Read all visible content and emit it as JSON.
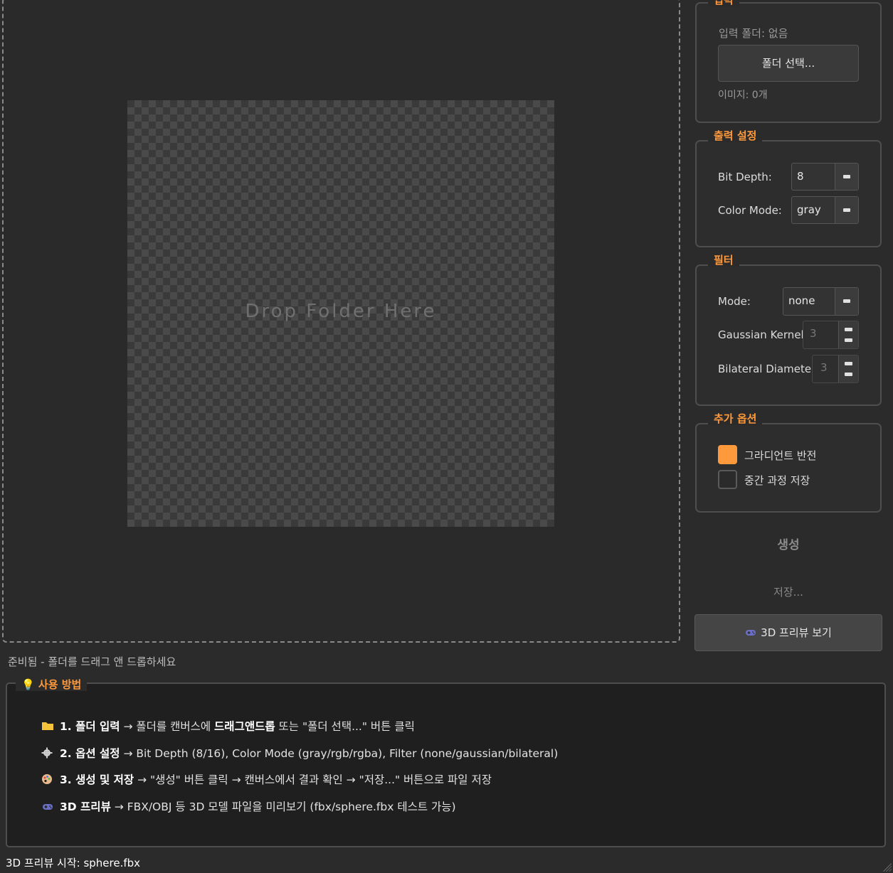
{
  "canvas": {
    "drop_text": "Drop Folder Here"
  },
  "status_message": "준비됨 - 폴더를 드래그 앤 드롭하세요",
  "input_group": {
    "title": "입력",
    "folder_label": "입력 폴더: 없음",
    "select_button": "폴더 선택...",
    "image_count": "이미지: 0개"
  },
  "output_group": {
    "title": "출력 설정",
    "bit_depth_label": "Bit Depth:",
    "bit_depth_value": "8",
    "color_mode_label": "Color Mode:",
    "color_mode_value": "gray"
  },
  "filter_group": {
    "title": "필터",
    "mode_label": "Mode:",
    "mode_value": "none",
    "gaussian_label": "Gaussian Kernel:",
    "gaussian_value": "3",
    "bilateral_label": "Bilateral Diameter:",
    "bilateral_value": "3"
  },
  "extra_group": {
    "title": "추가 옵션",
    "invert_label": "그라디언트 반전",
    "invert_checked": true,
    "save_steps_label": "중간 과정 저장",
    "save_steps_checked": false
  },
  "actions": {
    "generate": "생성",
    "save": "저장...",
    "preview_3d": "3D 프리뷰 보기"
  },
  "usage": {
    "title": "사용 방법",
    "lines": [
      {
        "icon": "folder-icon",
        "bold": "1. 폴더 입력",
        "pre": " → 폴더를 캔버스에 ",
        "bold2": "드래그앤드롭",
        "text": " 또는 \"폴더 선택...\" 버튼 클릭"
      },
      {
        "icon": "gear-icon",
        "bold": "2. 옵션 설정",
        "text": " → Bit Depth (8/16), Color Mode (gray/rgb/rgba), Filter (none/gaussian/bilateral)"
      },
      {
        "icon": "palette-icon",
        "bold": "3. 생성 및 저장",
        "text": " → \"생성\" 버튼 클릭 → 캔버스에서 결과 확인 → \"저장...\" 버튼으로 파일 저장"
      },
      {
        "icon": "gamepad-icon",
        "bold": "3D 프리뷰",
        "text": " → FBX/OBJ 등 3D 모델 파일을 미리보기 (fbx/sphere.fbx 테스트 가능)"
      }
    ]
  },
  "bottom_status": "3D 프리뷰 시작: sphere.fbx",
  "colors": {
    "accent": "#ff9a3c",
    "background": "#2b2b2b"
  }
}
